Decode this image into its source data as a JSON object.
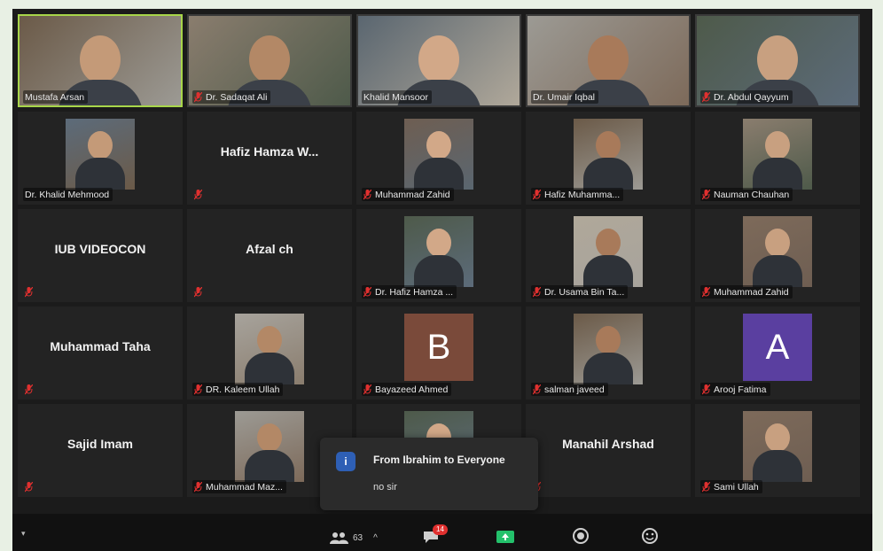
{
  "participants": [
    {
      "name": "Mustafa Arsan",
      "type": "video",
      "active": true,
      "muted": false
    },
    {
      "name": "Dr. Sadaqat Ali",
      "type": "video",
      "muted": true
    },
    {
      "name": "Khalid Mansoor",
      "type": "video",
      "muted": false
    },
    {
      "name": "Dr. Umair Iqbal",
      "type": "video",
      "muted": false
    },
    {
      "name": "Dr. Abdul Qayyum",
      "type": "video",
      "muted": true
    },
    {
      "name": "Dr. Khalid Mehmood",
      "type": "thumb",
      "muted": false
    },
    {
      "name": "Hafiz Hamza W...",
      "type": "text",
      "muted": true
    },
    {
      "name": "Muhammad Zahid",
      "type": "thumb",
      "muted": true
    },
    {
      "name": "Hafiz Muhamma...",
      "type": "thumb",
      "muted": true
    },
    {
      "name": "Nauman Chauhan",
      "type": "thumb",
      "muted": true
    },
    {
      "name": "IUB VIDEOCON",
      "type": "text",
      "muted": true
    },
    {
      "name": "Afzal ch",
      "type": "text",
      "muted": true
    },
    {
      "name": "Dr. Hafiz Hamza ...",
      "type": "thumb",
      "muted": true
    },
    {
      "name": "Dr. Usama Bin Ta...",
      "type": "thumb",
      "muted": true
    },
    {
      "name": "Muhammad Zahid",
      "type": "thumb",
      "muted": true
    },
    {
      "name": "Muhammad Taha",
      "type": "text",
      "muted": true
    },
    {
      "name": "DR. Kaleem Ullah",
      "type": "thumb",
      "muted": true
    },
    {
      "name": "Bayazeed Ahmed",
      "type": "letter",
      "letter": "B",
      "color": "#7a4a3a",
      "muted": true
    },
    {
      "name": "salman javeed",
      "type": "thumb",
      "muted": true
    },
    {
      "name": "Arooj Fatima",
      "type": "letter",
      "letter": "A",
      "color": "#5a3fa0",
      "muted": true
    },
    {
      "name": "Sajid Imam",
      "type": "text",
      "muted": true
    },
    {
      "name": "Muhammad Maz...",
      "type": "thumb",
      "muted": true
    },
    {
      "name": "",
      "type": "thumb",
      "muted": false
    },
    {
      "name": "Manahil Arshad",
      "type": "text",
      "muted": true
    },
    {
      "name": "Sami Ullah",
      "type": "thumb",
      "muted": true
    }
  ],
  "chat": {
    "from": "From Ibrahim to Everyone",
    "message": "no sir",
    "icon": "chat-bubble-icon"
  },
  "toolbar": {
    "participants_count": "63",
    "chat_badge": "14"
  },
  "colors": {
    "active_border": "#a8d64a",
    "mute_icon": "#e0302f",
    "tile_bg": "#232323",
    "chat_badge": "#e0302f"
  }
}
